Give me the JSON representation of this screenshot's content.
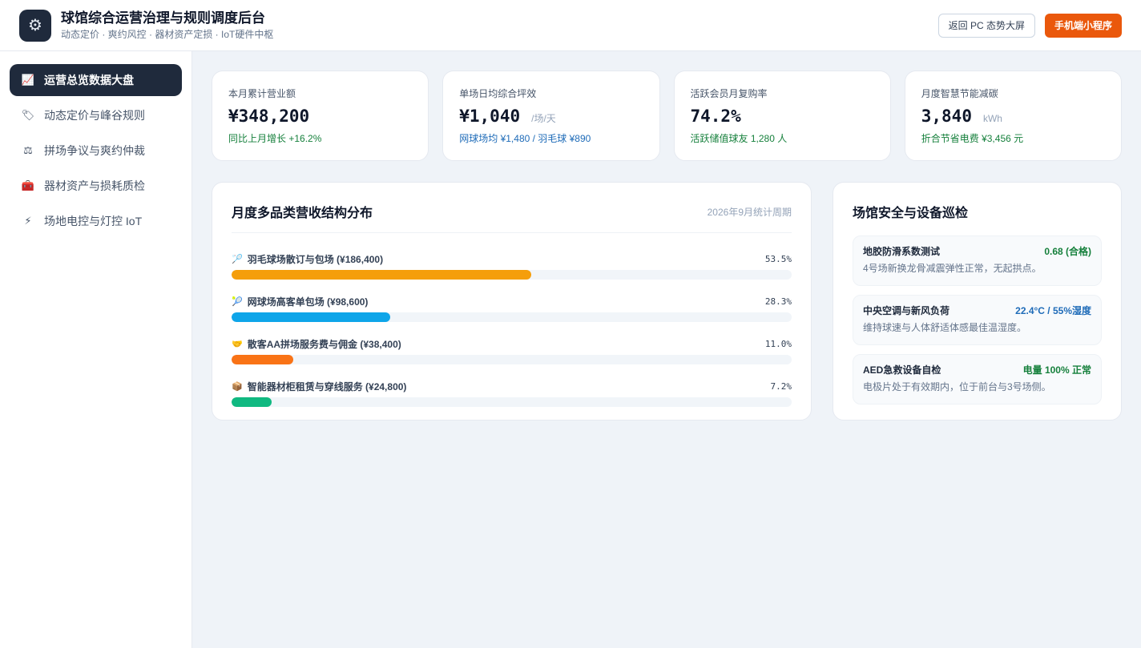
{
  "header": {
    "logo_icon": "gear-icon",
    "title": "球馆综合运营治理与规则调度后台",
    "subtitle": "动态定价 · 爽约风控 · 器材资产定损 · IoT硬件中枢",
    "back_button": "返回 PC 态势大屏",
    "mini_program_button": "手机端小程序"
  },
  "sidebar": {
    "items": [
      {
        "label": "运营总览数据大盘",
        "icon": "chart-icon",
        "glyph": "📈",
        "active": true
      },
      {
        "label": "动态定价与峰谷规则",
        "icon": "price-tag-icon",
        "glyph": "🏷",
        "active": false
      },
      {
        "label": "拼场争议与爽约仲裁",
        "icon": "scales-icon",
        "glyph": "⚖",
        "active": false
      },
      {
        "label": "器材资产与损耗质检",
        "icon": "toolbox-icon",
        "glyph": "🧰",
        "active": false
      },
      {
        "label": "场地电控与灯控 IoT",
        "icon": "lightning-icon",
        "glyph": "⚡",
        "active": false
      }
    ]
  },
  "stats": [
    {
      "label": "本月累计营业额",
      "value": "¥348,200",
      "unit": "",
      "note": "同比上月增长 +16.2%",
      "note_color": "green"
    },
    {
      "label": "单场日均综合坪效",
      "value": "¥1,040",
      "unit": "/场/天",
      "note": "网球场均 ¥1,480 / 羽毛球 ¥890",
      "note_color": "blue"
    },
    {
      "label": "活跃会员月复购率",
      "value": "74.2%",
      "unit": "",
      "note": "活跃储值球友 1,280 人",
      "note_color": "green"
    },
    {
      "label": "月度智慧节能减碳",
      "value": "3,840",
      "unit": "kWh",
      "note": "折合节省电费 ¥3,456 元",
      "note_color": "green"
    }
  ],
  "revenue": {
    "title": "月度多品类营收结构分布",
    "period": "2026年9月统计周期",
    "items": [
      {
        "icon": "badminton-icon",
        "glyph": "🏸",
        "label": "羽毛球场散订与包场 (¥186,400)",
        "pct": "53.5%",
        "fraction": 0.535,
        "color": "#f59e0b"
      },
      {
        "icon": "tennis-icon",
        "glyph": "🎾",
        "label": "网球场高客单包场 (¥98,600)",
        "pct": "28.3%",
        "fraction": 0.283,
        "color": "#0ea5e9"
      },
      {
        "icon": "handshake-icon",
        "glyph": "🤝",
        "label": "散客AA拼场服务费与佣金 (¥38,400)",
        "pct": "11.0%",
        "fraction": 0.11,
        "color": "#f97316"
      },
      {
        "icon": "box-icon",
        "glyph": "📦",
        "label": "智能器材柜租赁与穿线服务 (¥24,800)",
        "pct": "7.2%",
        "fraction": 0.072,
        "color": "#10b981"
      }
    ]
  },
  "safety": {
    "title": "场馆安全与设备巡检",
    "items": [
      {
        "name": "地胶防滑系数测试",
        "value": "0.68 (合格)",
        "value_color": "#16803c",
        "desc": "4号场新换龙骨减震弹性正常，无起拱点。"
      },
      {
        "name": "中央空调与新风负荷",
        "value": "22.4°C / 55%湿度",
        "value_color": "#1e6bb8",
        "desc": "维持球速与人体舒适体感最佳温湿度。"
      },
      {
        "name": "AED急救设备自检",
        "value": "电量 100% 正常",
        "value_color": "#16803c",
        "desc": "电极片处于有效期内，位于前台与3号场侧。"
      }
    ]
  }
}
